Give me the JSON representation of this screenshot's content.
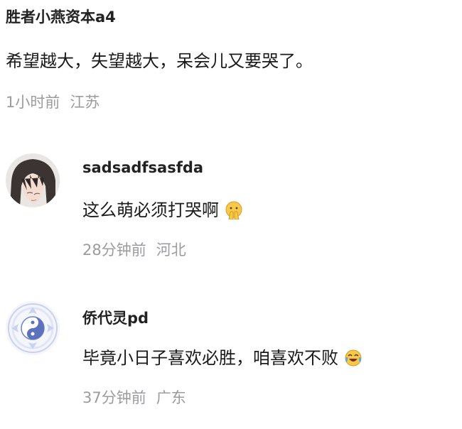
{
  "top_comment": {
    "author": "胜者小燕资本a4",
    "text": "希望越大，失望越大，呆会儿又要哭了。",
    "time": "1小时前",
    "location": "江苏"
  },
  "replies": [
    {
      "author": "sadsadfsasfda",
      "text": "这么萌必须打哭啊",
      "emoji": "pleading-hands-emoji",
      "time": "28分钟前",
      "location": "河北",
      "avatar": "anime-character-avatar"
    },
    {
      "author": "侨代灵pd",
      "text": "毕竟小日子喜欢必胜，咱喜欢不败",
      "emoji": "tears-of-joy-emoji",
      "time": "37分钟前",
      "location": "广东",
      "avatar": "yin-yang-avatar"
    }
  ],
  "colors": {
    "text": "#1a1a1a",
    "meta": "#9b9ba1",
    "author": "#222222"
  }
}
